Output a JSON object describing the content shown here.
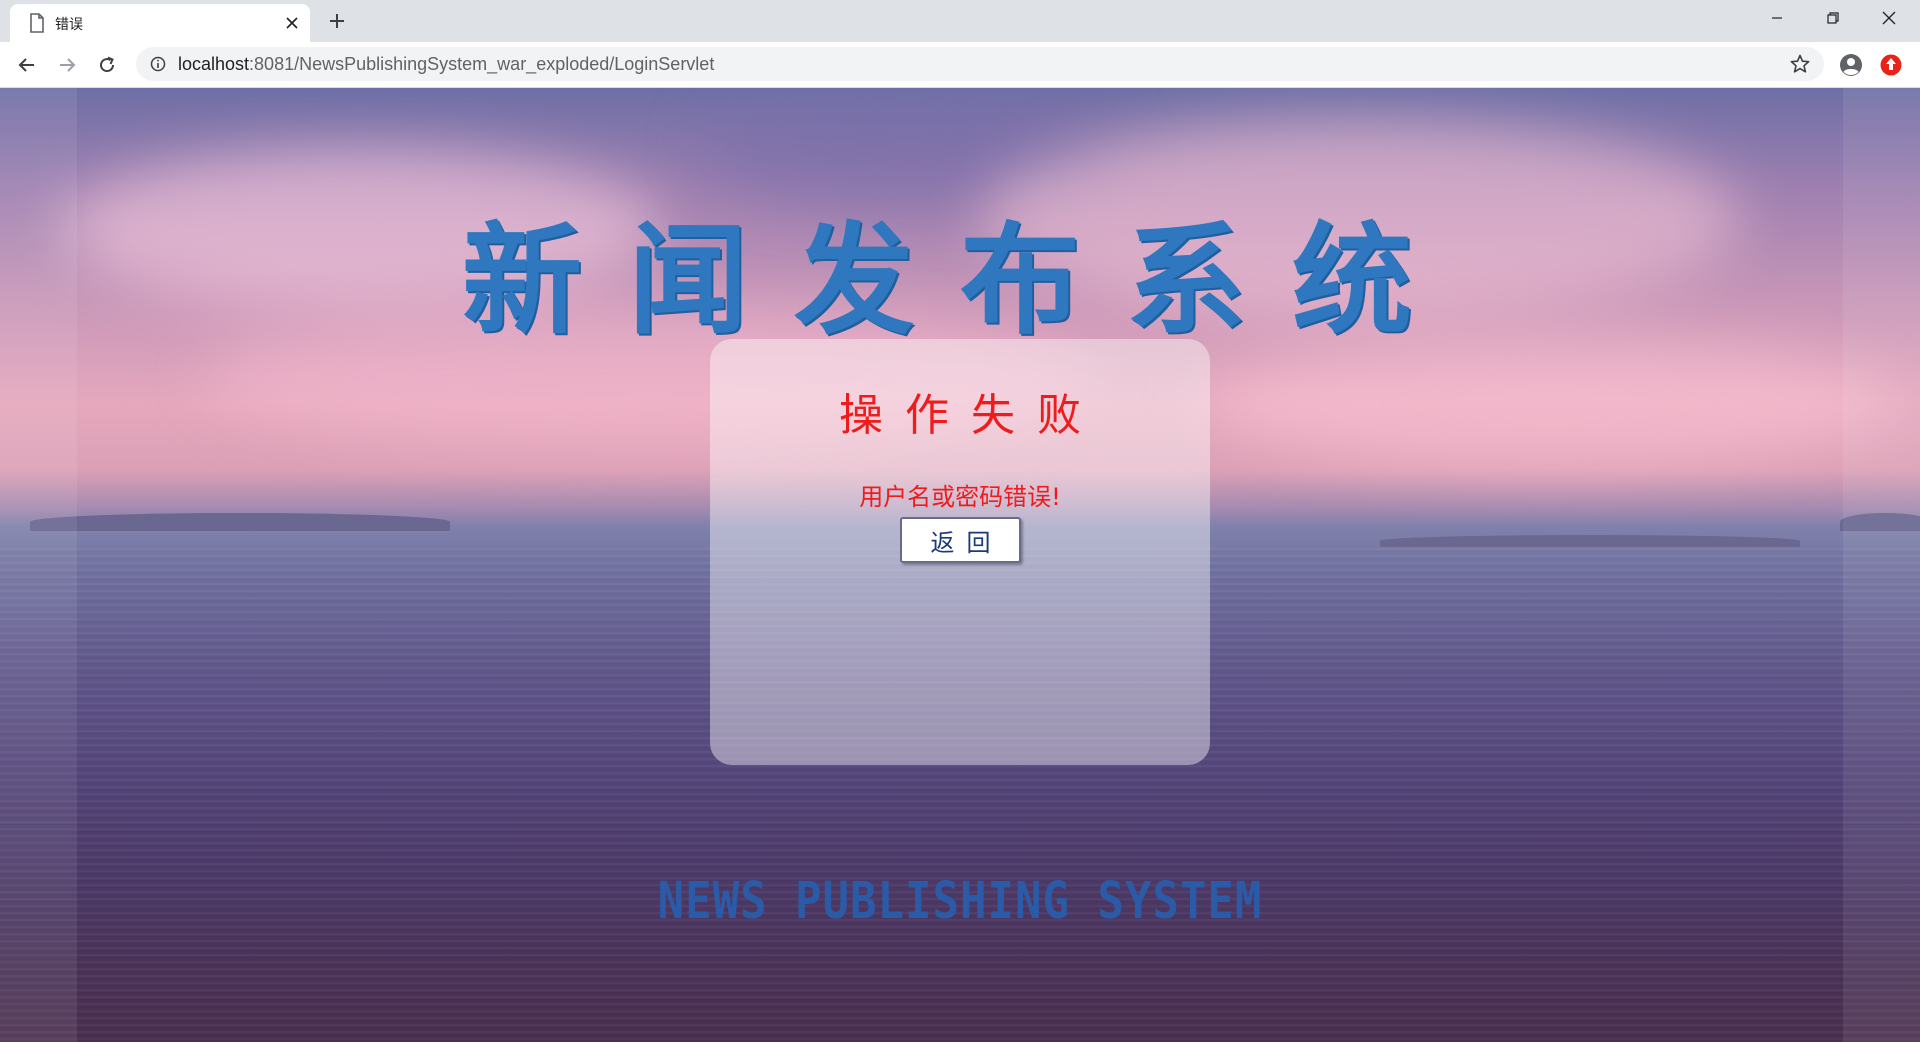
{
  "browser": {
    "tab": {
      "title": "错误"
    },
    "new_tab_label": "+",
    "address_bar": {
      "host": "localhost",
      "path": ":8081/NewsPublishingSystem_war_exploded/LoginServlet"
    },
    "icons": {
      "tab": "page-icon",
      "close": "close-icon",
      "back": "back-arrow-icon",
      "forward": "forward-arrow-icon",
      "reload": "reload-icon",
      "info": "info-icon",
      "bookmark": "star-icon",
      "profile": "profile-icon",
      "extension": "extension-icon"
    }
  },
  "page": {
    "title": "新闻发布系统",
    "panel": {
      "heading": "操作失败",
      "message": "用户名或密码错误!",
      "back_button_label": "返回"
    },
    "footer": "NEWS PUBLISHING SYSTEM"
  },
  "colors": {
    "title": "#2f77bf",
    "error_text": "#ee1c1c",
    "button_text": "#1d3a78",
    "footer_text": "#2b5aa6"
  }
}
